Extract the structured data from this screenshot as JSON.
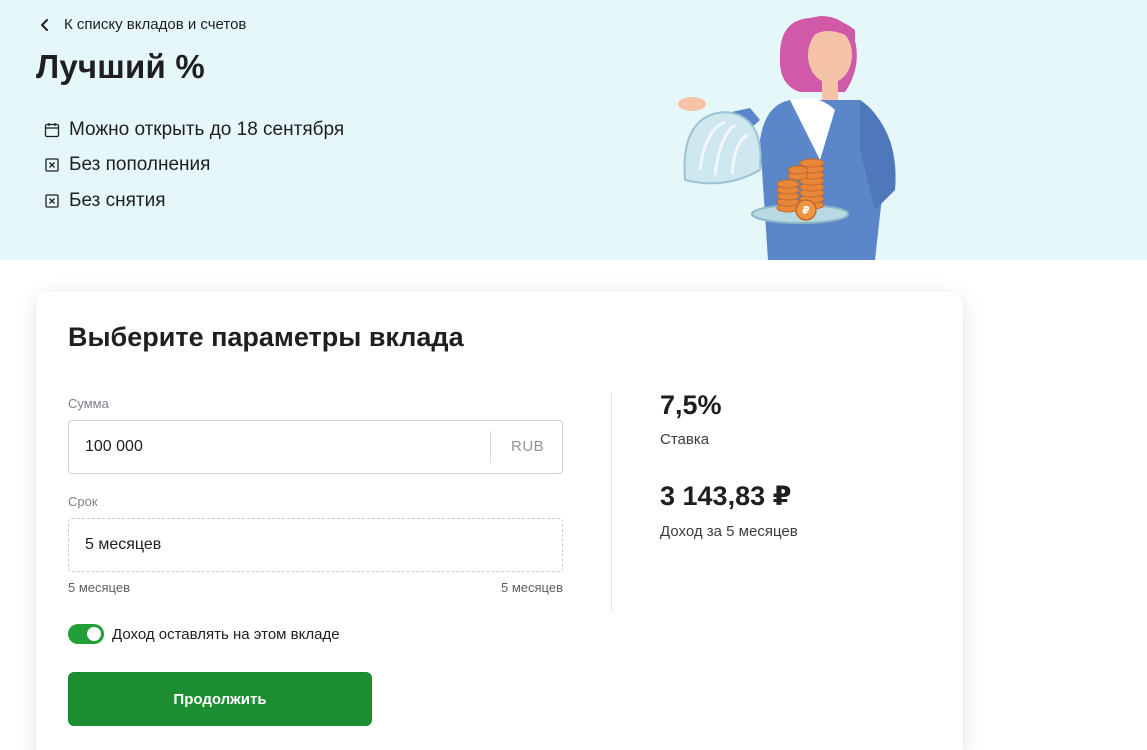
{
  "colors": {
    "hero_bg": "#e6f7f9",
    "primary_green": "#1c8d31",
    "toggle_green": "#21a038",
    "text": "#1f1f22",
    "muted": "#7d838a"
  },
  "header": {
    "back_label": "К списку вкладов и счетов",
    "back_icon": "chevron-left-icon",
    "title": "Лучший %",
    "features": [
      {
        "icon": "calendar-icon",
        "text": "Можно открыть до 18 сентября"
      },
      {
        "icon": "crossed-box-icon",
        "text": "Без пополнения"
      },
      {
        "icon": "crossed-box-icon",
        "text": "Без снятия"
      }
    ],
    "illustration": "woman-with-coins-tray-illustration"
  },
  "form": {
    "title": "Выберите параметры вклада",
    "amount": {
      "label": "Сумма",
      "value": "100 000",
      "currency": "RUB"
    },
    "term": {
      "label": "Срок",
      "value": "5 месяцев",
      "min_label": "5 месяцев",
      "max_label": "5 месяцев"
    },
    "toggle": {
      "label": "Доход оставлять на этом вкладе",
      "on": true
    },
    "continue_label": "Продолжить"
  },
  "summary": {
    "rate_value": "7,5%",
    "rate_label": "Ставка",
    "income_value": "3 143,83 ₽",
    "income_label": "Доход за 5 месяцев"
  }
}
